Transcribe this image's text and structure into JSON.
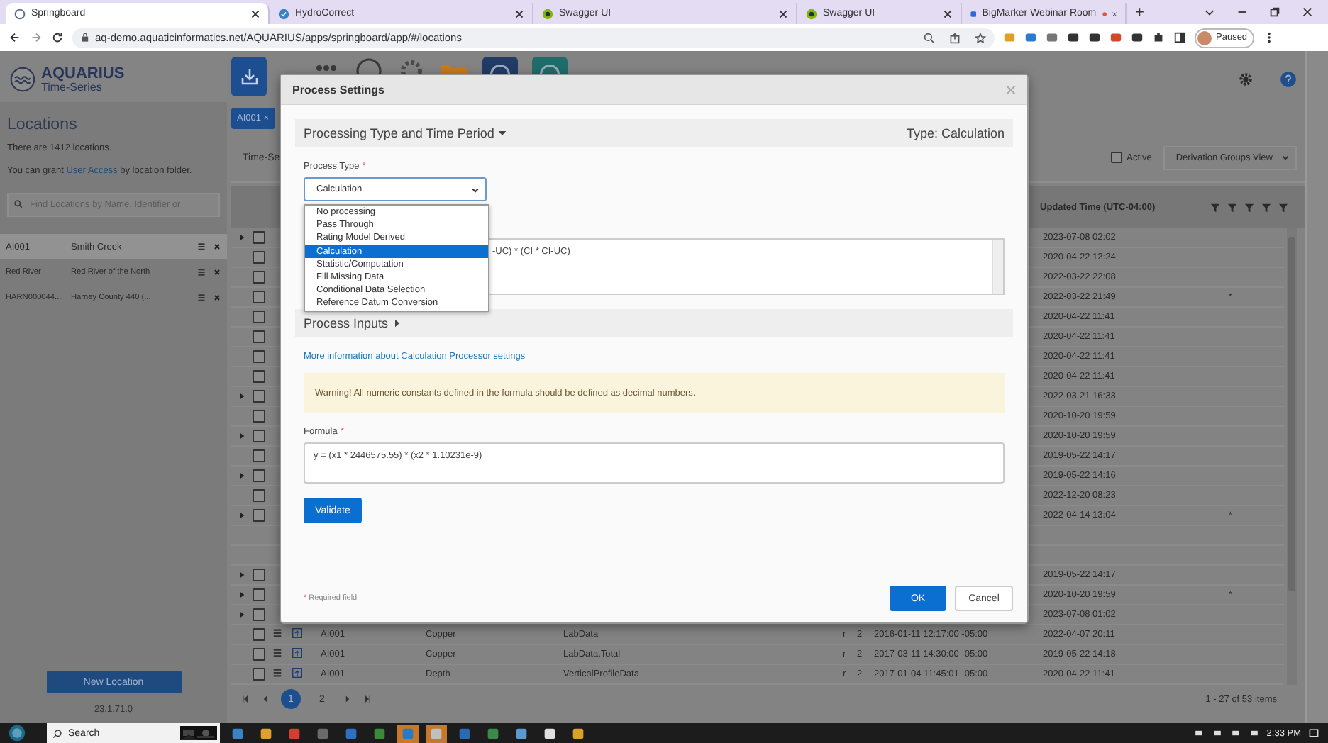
{
  "browser": {
    "tabs": [
      {
        "title": "Springboard",
        "kind": "springboard",
        "selected": true,
        "recording": false
      },
      {
        "title": "HydroCorrect",
        "kind": "check",
        "selected": false,
        "recording": false
      },
      {
        "title": "Swagger UI",
        "kind": "swagger",
        "selected": false,
        "recording": false
      },
      {
        "title": "Swagger UI",
        "kind": "swagger",
        "selected": false,
        "recording": false
      },
      {
        "title": "BigMarker Webinar Room",
        "kind": "bigmarker",
        "selected": false,
        "recording": true
      }
    ],
    "new_tab": "+",
    "url": "aq-demo.aquaticinformatics.net/AQUARIUS/apps/springboard/app/#/locations",
    "profile": "Paused"
  },
  "logo": {
    "name": "AQUARIUS",
    "subtitle": "Time-Series"
  },
  "sidebar": {
    "title": "Locations",
    "count_text": "There are 1412 locations.",
    "access_before": "You can grant ",
    "access_link": "User Access",
    "access_after": " by location folder.",
    "search": {
      "placeholder": "Find Locations by Name, Identifier or"
    },
    "items": [
      {
        "id_text": "AI001",
        "name": "Smith Creek",
        "selected": true
      },
      {
        "id_text": "Red River",
        "name": "Red River of the North",
        "selected": false
      },
      {
        "id_text": "HARN000044...",
        "name": "Harney County 440 (...",
        "selected": false
      }
    ],
    "new_button": "New Location",
    "version": "23.1.71.0"
  },
  "main": {
    "filter_chip": "AI001",
    "chip_close": "×",
    "tab_fragment": "Time-Se",
    "active_filter": {
      "label": "Active",
      "checked": false
    },
    "view_select": "Derivation Groups View",
    "table": {
      "columns": [
        {
          "label": "Updated Time (UTC-04:00)"
        }
      ],
      "rows": [
        {
          "kind": "partial",
          "expandable": true,
          "checked": false,
          "updated": "2023-07-08 02:02"
        },
        {
          "kind": "partial",
          "expandable": false,
          "checked": false,
          "updated": "2020-04-22 12:24"
        },
        {
          "kind": "partial",
          "expandable": false,
          "checked": false,
          "updated": "2022-03-22 22:08"
        },
        {
          "kind": "partial",
          "expandable": false,
          "checked": false,
          "updated": "2022-03-22 21:49",
          "flag": "*"
        },
        {
          "kind": "partial",
          "expandable": false,
          "checked": false,
          "updated": "2020-04-22 11:41"
        },
        {
          "kind": "partial",
          "expandable": false,
          "checked": false,
          "updated": "2020-04-22 11:41"
        },
        {
          "kind": "partial",
          "expandable": false,
          "checked": false,
          "updated": "2020-04-22 11:41"
        },
        {
          "kind": "partial",
          "expandable": false,
          "checked": false,
          "updated": "2020-04-22 11:41"
        },
        {
          "kind": "partial",
          "expandable": true,
          "checked": false,
          "updated": "2022-03-21 16:33"
        },
        {
          "kind": "partial",
          "expandable": false,
          "checked": false,
          "updated": "2020-10-20 19:59"
        },
        {
          "kind": "partial",
          "expandable": true,
          "checked": false,
          "updated": "2020-10-20 19:59"
        },
        {
          "kind": "partial",
          "expandable": false,
          "checked": false,
          "updated": "2019-05-22 14:17"
        },
        {
          "kind": "partial",
          "expandable": true,
          "checked": false,
          "updated": "2019-05-22 14:16"
        },
        {
          "kind": "partial",
          "expandable": false,
          "checked": false,
          "updated": "2022-12-20 08:23"
        },
        {
          "kind": "partial",
          "expandable": true,
          "checked": false,
          "updated": "2022-04-14 13:04",
          "flag": "*"
        },
        {
          "kind": "empty"
        },
        {
          "kind": "empty"
        },
        {
          "kind": "partial",
          "expandable": true,
          "checked": false,
          "updated": "2019-05-22 14:17"
        },
        {
          "kind": "partial",
          "expandable": true,
          "checked": false,
          "updated": "2020-10-20 19:59",
          "flag": "*"
        },
        {
          "kind": "partial",
          "expandable": true,
          "checked": false,
          "updated": "2023-07-08 01:02"
        },
        {
          "kind": "full",
          "expandable": false,
          "checked": false,
          "location": "AI001",
          "parameter": "Copper",
          "label": "LabData",
          "column_r": "r",
          "column_n": "2",
          "start": "2016-01-11 12:17:00 -05:00",
          "updated": "2022-04-07 20:11"
        },
        {
          "kind": "full",
          "expandable": false,
          "checked": false,
          "location": "AI001",
          "parameter": "Copper",
          "label": "LabData.Total",
          "column_r": "r",
          "column_n": "2",
          "start": "2017-03-11 14:30:00 -05:00",
          "updated": "2019-05-22 14:18"
        },
        {
          "kind": "full",
          "expandable": false,
          "checked": false,
          "location": "AI001",
          "parameter": "Depth",
          "label": "VerticalProfileData",
          "column_r": "r",
          "column_n": "2",
          "start": "2017-01-04 11:45:01 -05:00",
          "updated": "2020-04-22 11:41"
        }
      ]
    },
    "pager": {
      "pages": [
        {
          "label": "1",
          "selected": true
        },
        {
          "label": "2",
          "selected": false
        }
      ],
      "summary": "1 - 27 of 53 items"
    }
  },
  "modal": {
    "title": "Process Settings",
    "section_title": "Processing Type and Time Period",
    "type_text": "Type: Calculation",
    "process_type": {
      "label": "Process Type",
      "required_mark": "*",
      "value": "Calculation",
      "expanded": true,
      "options": [
        {
          "label": "No processing",
          "selected": false
        },
        {
          "label": "Pass Through",
          "selected": false
        },
        {
          "label": "Rating Model Derived",
          "selected": false
        },
        {
          "label": "Calculation",
          "selected": true
        },
        {
          "label": "Statistic/Computation",
          "selected": false
        },
        {
          "label": "Fill Missing Data",
          "selected": false
        },
        {
          "label": "Conditional Data Selection",
          "selected": false
        },
        {
          "label": "Reference Datum Conversion",
          "selected": false
        }
      ]
    },
    "hidden_field_text": "-UC) * (CI * CI-UC)",
    "inputs_title": "Process Inputs",
    "info_link": "More information about Calculation Processor settings",
    "warning": "Warning! All numeric constants defined in the formula should be defined as decimal numbers.",
    "formula": {
      "label": "Formula",
      "required_mark": "*",
      "value": "y = (x1 * 2446575.55) * (x2 * 1.10231e-9)"
    },
    "validate": "Validate",
    "required_note": {
      "mark": "*",
      "text": "Required field"
    },
    "ok": "OK",
    "cancel": "Cancel"
  },
  "taskbar": {
    "search": "Search",
    "time": "2:33 PM"
  }
}
